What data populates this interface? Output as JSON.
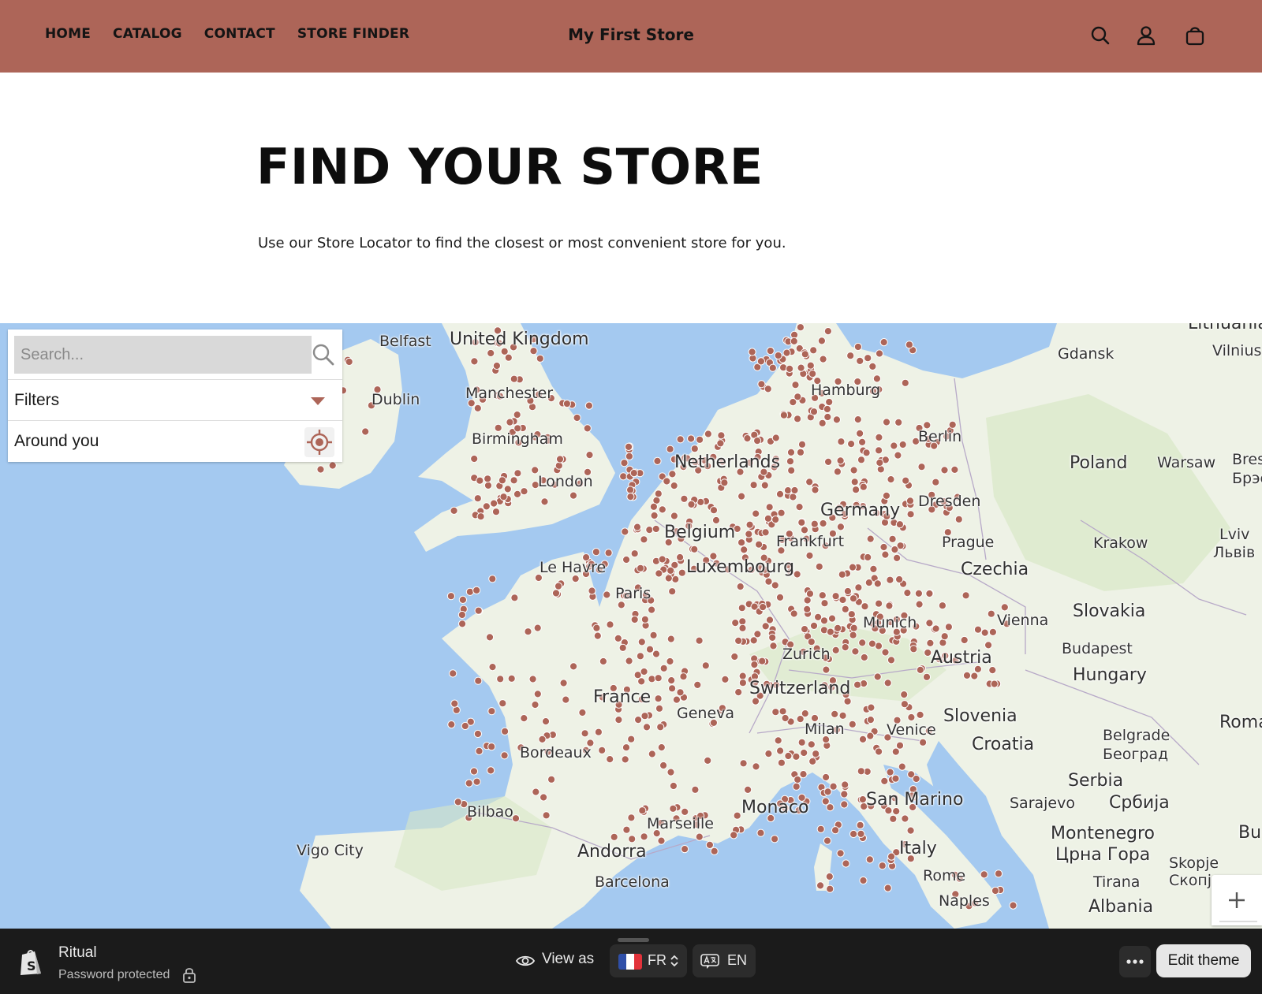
{
  "header": {
    "nav": [
      {
        "label": "HOME"
      },
      {
        "label": "CATALOG"
      },
      {
        "label": "CONTACT"
      },
      {
        "label": "STORE FINDER"
      }
    ],
    "brand": "My First Store",
    "icons": [
      "search-icon",
      "account-icon",
      "cart-icon"
    ],
    "bg_color": "#ad6558"
  },
  "hero": {
    "title": "FIND YOUR STORE",
    "subtitle": "Use our Store Locator to find the closest or most convenient store for you."
  },
  "locator": {
    "search_placeholder": "Search...",
    "filters_label": "Filters",
    "around_label": "Around you",
    "marker_color": "#ad6558"
  },
  "map": {
    "countries": [
      "United Kingdom",
      "Netherlands",
      "Belgium",
      "Luxembourg",
      "Germany",
      "Czechia",
      "Poland",
      "Slovakia",
      "Austria",
      "Hungary",
      "Switzerland",
      "France",
      "Slovenia",
      "Croatia",
      "Serbia",
      "Montenegro",
      "Albania",
      "Italy",
      "San Marino",
      "Monaco",
      "Andorra",
      "Lithuania"
    ],
    "cities": [
      "Belfast",
      "Dublin",
      "Manchester",
      "Birmingham",
      "London",
      "Le Havre",
      "Paris",
      "Hamburg",
      "Berlin",
      "Dresden",
      "Frankfurt",
      "Prague",
      "Gdansk",
      "Warsaw",
      "Vilnius",
      "Krakow",
      "Lviv",
      "Львів",
      "Munich",
      "Vienna",
      "Budapest",
      "Zurich",
      "Geneva",
      "Milan",
      "Venice",
      "Bordeaux",
      "Bilbao",
      "Marseille",
      "Vigo City",
      "Barcelona",
      "Rome",
      "Naples",
      "Sarajevo",
      "Belgrade",
      "Београд",
      "Србија",
      "Црна Гора",
      "Tirana",
      "Skopje",
      "Скопје",
      "Roma",
      "Bres",
      "Брэс",
      "Bu"
    ],
    "land_color": "#eef2e6",
    "water_color": "#a4c9f0"
  },
  "bottombar": {
    "theme_name": "Ritual",
    "theme_status": "Password protected",
    "view_as": "View as",
    "country": "FR",
    "language": "EN",
    "edit_label": "Edit theme"
  }
}
